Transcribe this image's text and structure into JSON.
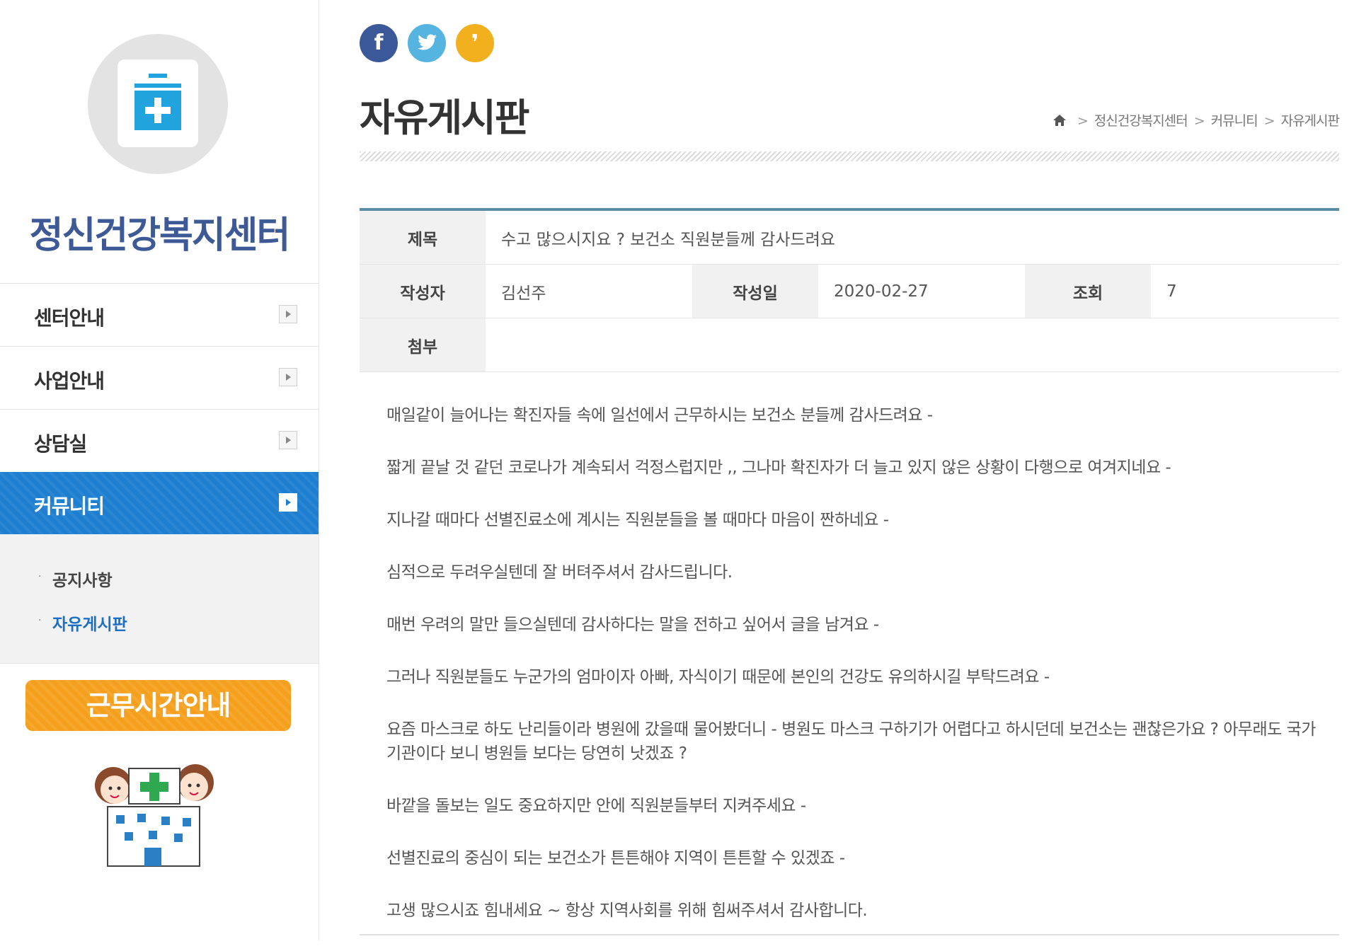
{
  "sidebar": {
    "center_name": "정신건강복지센터",
    "menu": [
      {
        "label": "센터안내",
        "active": false
      },
      {
        "label": "사업안내",
        "active": false
      },
      {
        "label": "상담실",
        "active": false
      },
      {
        "label": "커뮤니티",
        "active": true
      }
    ],
    "submenu": [
      {
        "label": "공지사항",
        "current": false
      },
      {
        "label": "자유게시판",
        "current": true
      }
    ],
    "hours_button": "근무시간안내"
  },
  "social": {
    "facebook": "f",
    "twitter_icon": "twitter-icon",
    "kakao": "❜",
    "colors": {
      "facebook": "#3b5998",
      "twitter": "#55b4e0",
      "kakao": "#f2b01e"
    }
  },
  "page": {
    "title": "자유게시판",
    "breadcrumb": [
      "정신건강복지센터",
      "커뮤니티",
      "자유게시판"
    ]
  },
  "post": {
    "subject_label": "제목",
    "subject": "수고 많으시지요 ? 보건소 직원분들께 감사드려요",
    "author_label": "작성자",
    "author": "김선주",
    "date_label": "작성일",
    "date": "2020-02-27",
    "views_label": "조회",
    "views": "7",
    "attachment_label": "첨부",
    "attachment": "",
    "body": [
      "매일같이 늘어나는 확진자들 속에 일선에서 근무하시는 보건소 분들께 감사드려요 -",
      "짧게 끝날 것 같던 코로나가 계속되서 걱정스럽지만 ,, 그나마 확진자가 더 늘고 있지 않은 상황이 다행으로 여겨지네요 -",
      "지나갈 때마다 선별진료소에 계시는 직원분들을 볼 때마다 마음이 짠하네요 -",
      "심적으로 두려우실텐데 잘 버텨주셔서 감사드립니다.",
      "매번 우려의 말만 들으실텐데 감사하다는 말을 전하고 싶어서 글을 남겨요 -",
      "그러나 직원분들도 누군가의 엄마이자 아빠, 자식이기 때문에 본인의 건강도 유의하시길 부탁드려요 -",
      "요즘 마스크로 하도 난리들이라 병원에 갔을때 물어봤더니 - 병원도 마스크 구하기가 어렵다고 하시던데 보건소는 괜찮은가요 ? 아무래도 국가 기관이다 보니 병원들 보다는 당연히 낫겠죠 ?",
      "바깥을 돌보는 일도 중요하지만 안에 직원분들부터 지켜주세요 -",
      "선별진료의 중심이 되는 보건소가 튼튼해야 지역이 튼튼할 수 있겠죠 -",
      "고생 많으시죠 힘내세요 ~ 항상 지역사회를 위해 힘써주셔서 감사합니다."
    ]
  }
}
